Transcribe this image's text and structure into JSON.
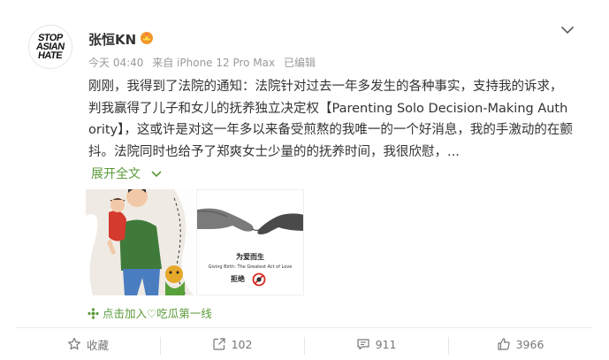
{
  "post": {
    "user": {
      "avatar_text": [
        "STOP",
        "ASIAN",
        "HATE"
      ],
      "name": "张恒KN"
    },
    "meta": {
      "time": "今天 04:40",
      "source": "来自 iPhone 12 Pro Max",
      "edited": "已编辑"
    },
    "text": "刚刚，我得到了法院的通知：法院针对过去一年多发生的各种事实，支持我的诉求，判我赢得了儿子和女儿的抚养独立决定权【Parenting Solo Decision-Making Authority】，这或许是对这一年多以来备受煎熬的我唯一的一个好消息，我的手激动的在颤抖。法院同时也给予了郑爽女士少量的的抚养时间，我很欣慰，...",
    "expand_label": "展开全文",
    "images": {
      "second_caption_main": "为爱而生",
      "second_caption_sub": "Giving Birth: The Greatest Act of Love",
      "second_caption_no": "拒绝"
    },
    "supertopic": "点击加入♡吃瓜第一线",
    "actions": {
      "favorite_label": "收藏",
      "repost_count": "102",
      "comment_count": "911",
      "like_count": "3966"
    }
  },
  "colors": {
    "link_green": "#5a9a3a",
    "meta_gray": "#9a9a9a",
    "text": "#333333"
  },
  "icons": [
    "crown-badge-icon",
    "chevron-down-icon",
    "chevron-down-small-icon",
    "sparkle-icon",
    "star-icon",
    "repost-icon",
    "comment-icon",
    "thumbs-up-icon"
  ]
}
